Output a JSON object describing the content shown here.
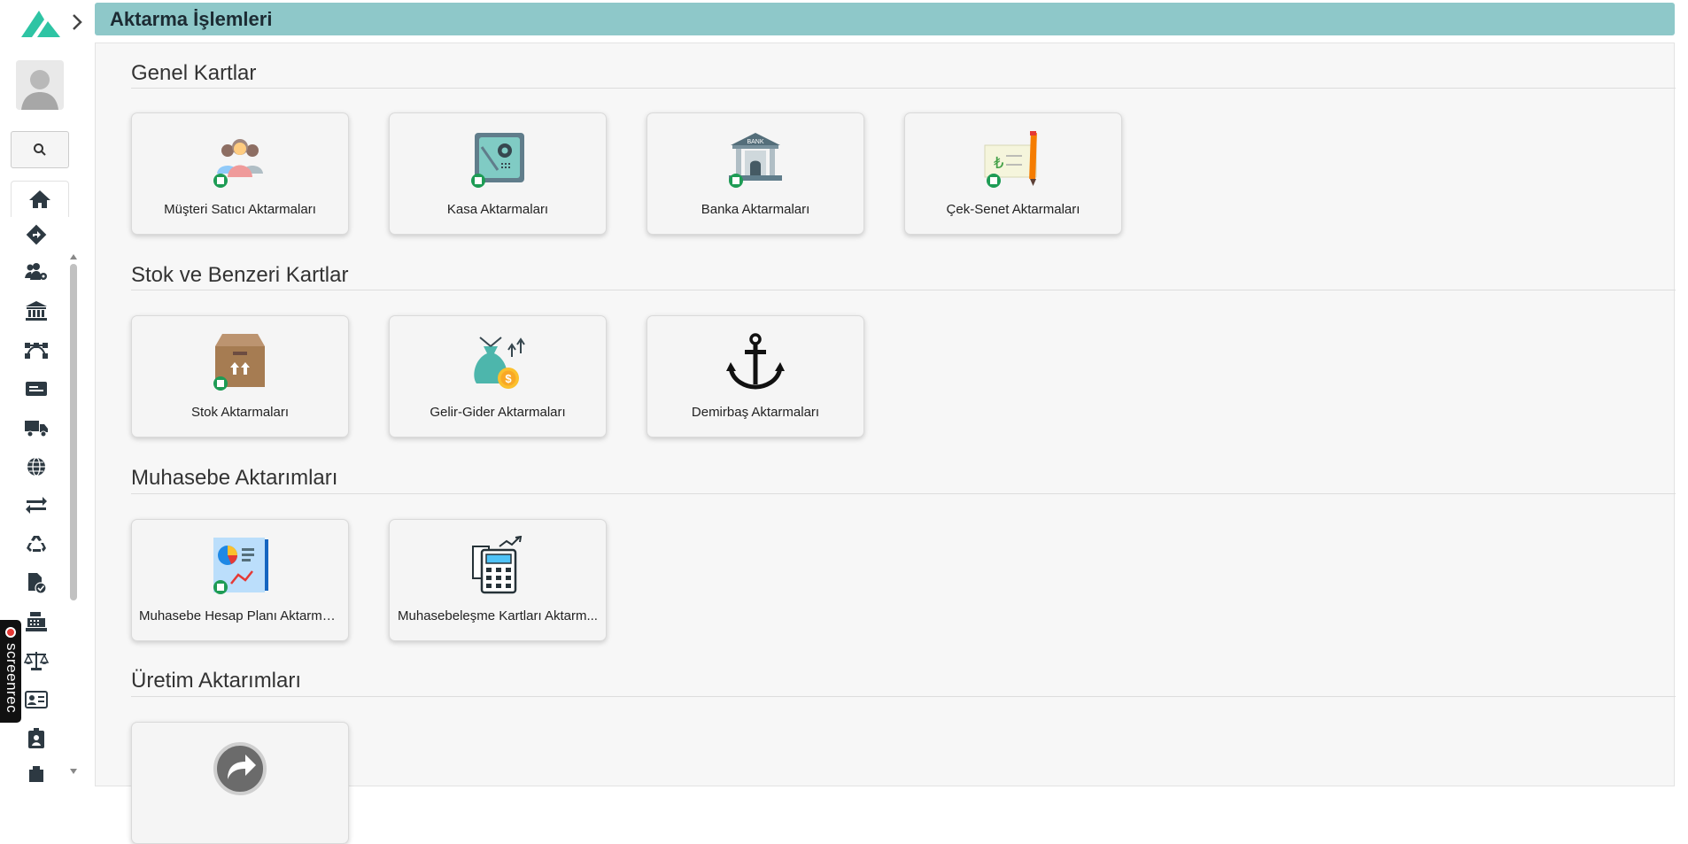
{
  "header": {
    "title": "Aktarma İşlemleri"
  },
  "sidebar": {
    "items": [
      {
        "icon": "home-icon"
      },
      {
        "icon": "directions-icon"
      },
      {
        "icon": "users-cog-icon"
      },
      {
        "icon": "bank-icon"
      },
      {
        "icon": "vector-nodes-icon"
      },
      {
        "icon": "card-icon"
      },
      {
        "icon": "truck-icon"
      },
      {
        "icon": "globe-icon"
      },
      {
        "icon": "transfer-arrows-icon"
      },
      {
        "icon": "recycle-icon"
      },
      {
        "icon": "file-check-icon"
      },
      {
        "icon": "cash-register-icon"
      },
      {
        "icon": "scale-icon"
      },
      {
        "icon": "id-card-icon"
      },
      {
        "icon": "id-badge-icon"
      }
    ]
  },
  "recorder": {
    "label": "screenrec"
  },
  "sections": [
    {
      "title": "Genel Kartlar",
      "cards": [
        {
          "label": "Müşteri Satıcı Aktarmaları",
          "icon": "people-icon"
        },
        {
          "label": "Kasa Aktarmaları",
          "icon": "safe-icon"
        },
        {
          "label": "Banka Aktarmaları",
          "icon": "bank-building-icon",
          "icon_text": "BANK"
        },
        {
          "label": "Çek-Senet Aktarmaları",
          "icon": "cheque-icon",
          "icon_text": "₺"
        }
      ]
    },
    {
      "title": "Stok ve Benzeri Kartlar",
      "cards": [
        {
          "label": "Stok Aktarmaları",
          "icon": "box-icon"
        },
        {
          "label": "Gelir-Gider Aktarmaları",
          "icon": "money-bag-icon",
          "icon_text": "$"
        },
        {
          "label": "Demirbaş Aktarmaları",
          "icon": "anchor-icon"
        }
      ]
    },
    {
      "title": "Muhasebe Aktarımları",
      "cards": [
        {
          "label": "Muhasebe Hesap Planı Aktarmal...",
          "icon": "report-chart-icon"
        },
        {
          "label": "Muhasebeleşme Kartları Aktarm...",
          "icon": "calculator-icon"
        }
      ]
    },
    {
      "title": "Üretim Aktarımları",
      "cards": [
        {
          "label": "",
          "icon": "redo-circle-icon"
        }
      ]
    }
  ],
  "colors": {
    "header_bg": "#8ec8c9",
    "logo": "#2ec4a4",
    "badge_green": "#1e9c55"
  }
}
